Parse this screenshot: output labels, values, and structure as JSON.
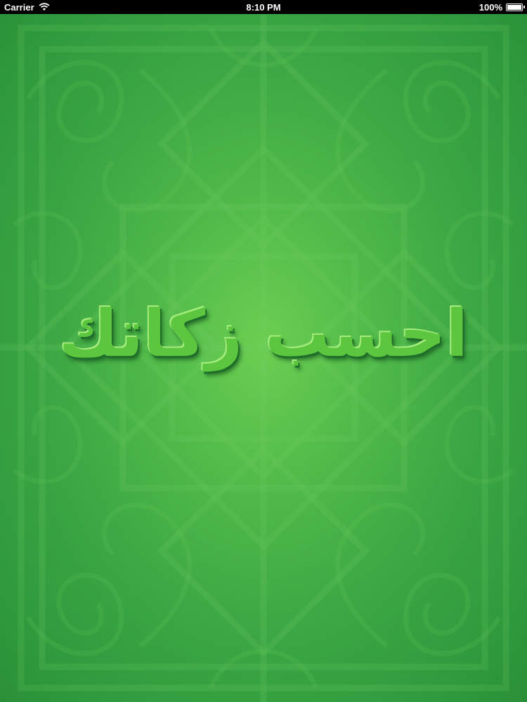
{
  "status_bar": {
    "carrier": "Carrier",
    "time": "8:10 PM",
    "battery_percent": "100%",
    "battery_level": 1.0
  },
  "splash": {
    "title": "احسب زكاتك",
    "colors": {
      "background_center": "#6ccf52",
      "background_edge": "#2a9038",
      "pattern_stroke": "#5cc05a",
      "title_fill": "#5cc63e"
    }
  }
}
